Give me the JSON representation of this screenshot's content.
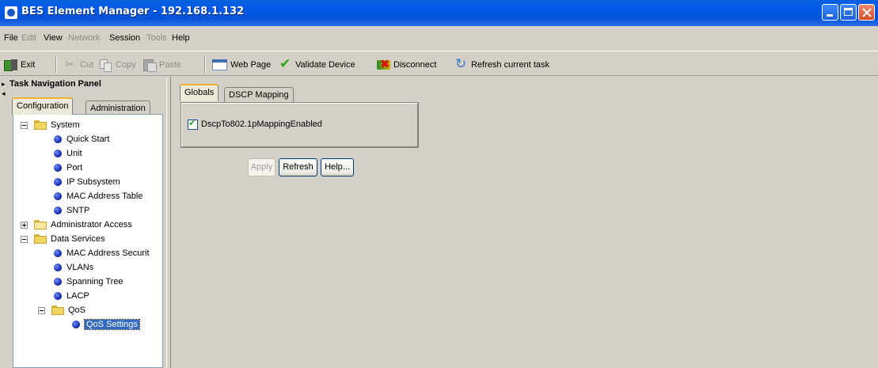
{
  "window": {
    "title": "BES Element Manager - 192.168.1.132"
  },
  "menu": {
    "items": [
      {
        "label": "File",
        "enabled": true
      },
      {
        "label": "Edit",
        "enabled": false
      },
      {
        "label": "View",
        "enabled": true
      },
      {
        "label": "Network",
        "enabled": false
      },
      {
        "label": "Session",
        "enabled": true
      },
      {
        "label": "Tools",
        "enabled": false
      },
      {
        "label": "Help",
        "enabled": true
      }
    ]
  },
  "toolbar": {
    "exit": "Exit",
    "cut": "Cut",
    "copy": "Copy",
    "paste": "Paste",
    "web_page": "Web Page",
    "validate": "Validate Device",
    "disconnect": "Disconnect",
    "refresh_task": "Refresh current task"
  },
  "nav": {
    "title": "Task Navigation Panel",
    "tabs": [
      "Configuration",
      "Administration"
    ],
    "active_tab": "Configuration",
    "tree": {
      "system": "System",
      "quick_start": "Quick Start",
      "unit": "Unit",
      "port": "Port",
      "ip_subsystem": "IP Subsystem",
      "mac_table": "MAC Address Table",
      "sntp": "SNTP",
      "admin_access": "Administrator Access",
      "data_services": "Data Services",
      "mac_security": "MAC Address Securit",
      "vlans": "VLANs",
      "spanning_tree": "Spanning Tree",
      "lacp": "LACP",
      "qos": "QoS",
      "qos_settings": "QoS Settings"
    },
    "selected": "QoS Settings"
  },
  "content": {
    "tabs": [
      "Globals",
      "DSCP Mapping"
    ],
    "active_tab": "Globals",
    "checkbox": {
      "label": "DscpTo802.1pMappingEnabled",
      "checked": true
    },
    "buttons": {
      "apply": "Apply",
      "refresh": "Refresh",
      "help": "Help..."
    }
  },
  "colors": {
    "titlebar": "#0058e6",
    "selection": "#316ac5",
    "bullet": "#0a1fa0",
    "checkmark": "#21a121"
  }
}
